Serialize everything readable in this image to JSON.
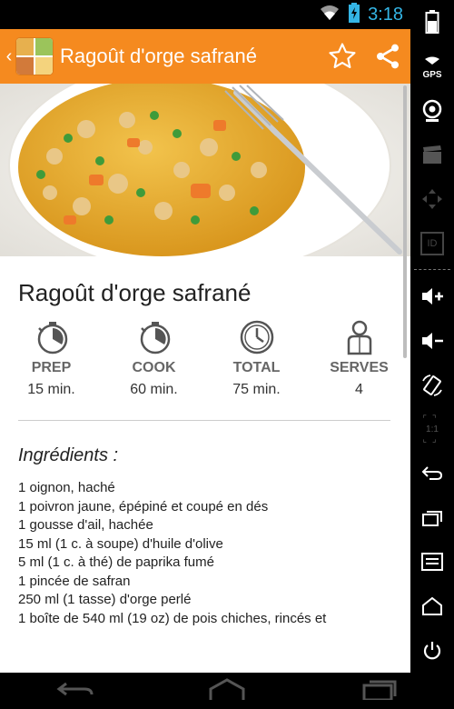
{
  "status": {
    "time": "3:18"
  },
  "actionbar": {
    "title": "Ragoût d'orge safrané"
  },
  "recipe": {
    "title": "Ragoût d'orge safrané",
    "stats": [
      {
        "label": "PREP",
        "value": "15 min."
      },
      {
        "label": "COOK",
        "value": "60 min."
      },
      {
        "label": "TOTAL",
        "value": "75 min."
      },
      {
        "label": "SERVES",
        "value": "4"
      }
    ],
    "ingredients_title": "Ingrédients :",
    "ingredients": [
      "1 oignon, haché",
      "1 poivron jaune, épépiné et coupé en dés",
      "1 gousse d'ail, hachée",
      "15 ml (1 c. à soupe) d'huile d'olive",
      "5 ml (1 c. à thé) de paprika fumé",
      "1 pincée de safran",
      "250 ml (1 tasse) d'orge perlé",
      "1 boîte de 540 ml (19 oz) de pois chiches, rincés et"
    ]
  },
  "sidebar": {
    "gps_label": "GPS",
    "id_label": "ID",
    "scale_label": "1:1"
  },
  "colors": {
    "accent": "#f58a1f",
    "clock": "#34b5e5"
  }
}
